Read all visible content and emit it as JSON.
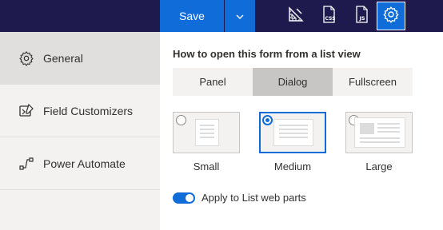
{
  "toolbar": {
    "save_label": "Save",
    "icons": [
      "save-dropdown-chevron-icon",
      "ruler-icon",
      "css-file-icon",
      "js-file-icon",
      "gear-icon"
    ]
  },
  "sidebar": {
    "items": [
      {
        "label": "General",
        "icon": "gear-icon",
        "selected": true
      },
      {
        "label": "Field Customizers",
        "icon": "field-customizer-icon",
        "selected": false
      },
      {
        "label": "Power Automate",
        "icon": "power-automate-icon",
        "selected": false
      }
    ]
  },
  "main": {
    "section_title": "How to open this form from a list view",
    "open_modes": [
      {
        "label": "Panel",
        "selected": false
      },
      {
        "label": "Dialog",
        "selected": true
      },
      {
        "label": "Fullscreen",
        "selected": false
      }
    ],
    "sizes": [
      {
        "label": "Small",
        "selected": false
      },
      {
        "label": "Medium",
        "selected": true
      },
      {
        "label": "Large",
        "selected": false
      }
    ],
    "toggle": {
      "label": "Apply to List web parts",
      "on": true
    }
  },
  "colors": {
    "topbar": "#1f1a4d",
    "accent": "#0f6cd8",
    "sidebar_bg": "#f3f2f1",
    "selected_bg": "#e1dfdd"
  }
}
